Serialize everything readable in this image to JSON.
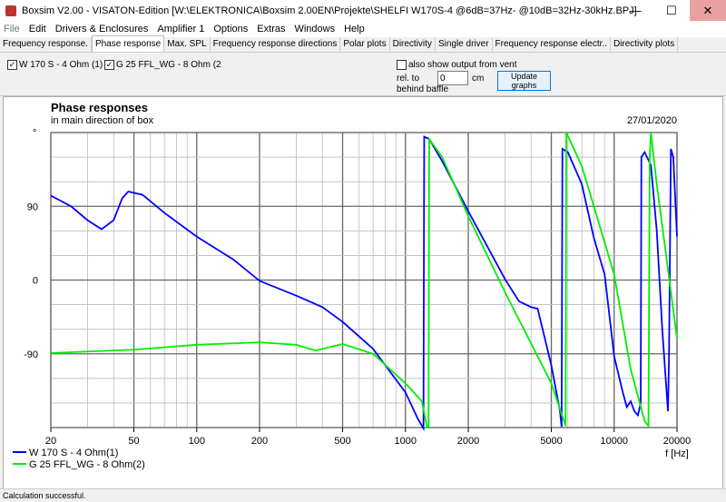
{
  "window": {
    "title": "Boxsim V2.00 - VISATON-Edition [W:\\ELEKTRONICA\\Boxsim 2.00EN\\Projekte\\SHELFI W170S-4 @6dB=37Hz- @10dB=32Hz-30kHz.BPJ]",
    "minimize": "—",
    "maximize": "☐",
    "close": "✕"
  },
  "menu": [
    "File",
    "Edit",
    "Drivers & Enclosures",
    "Amplifier 1",
    "Options",
    "Extras",
    "Windows",
    "Help"
  ],
  "tabs": [
    "Frequency response.",
    "Phase response",
    "Max. SPL",
    "Frequency response directions",
    "Polar plots",
    "Directivity",
    "Single driver",
    "Frequency response electr..",
    "Directivity plots"
  ],
  "active_tab": 1,
  "controls": {
    "driver1": "W 170 S - 4 Ohm (1)",
    "driver2": "G 25 FFL_WG - 8 Ohm (2",
    "vent_label": "also show output from vent",
    "rel_label": "rel. to",
    "behind_label": "behind baffle",
    "distance": "0",
    "unit": "cm",
    "update": "Update graphs"
  },
  "status": "Calculation successful.",
  "chart_data": {
    "type": "line",
    "title": "Phase responses",
    "subtitle": "in main direction of box",
    "date": "27/01/2020",
    "ylabel": "°",
    "xlabel": "f [Hz]",
    "xscale": "log",
    "xlim": [
      20,
      20000
    ],
    "ylim": [
      -180,
      180
    ],
    "xticks": [
      20,
      50,
      100,
      200,
      500,
      1000,
      2000,
      5000,
      10000,
      20000
    ],
    "yticks": [
      90,
      0,
      -90
    ],
    "grid": true,
    "legend": "bottom-left",
    "series": [
      {
        "name": "W 170 S - 4 Ohm(1)",
        "color": "#0000ff",
        "x": [
          20,
          25,
          30,
          35,
          40,
          44,
          47,
          55,
          70,
          100,
          150,
          200,
          300,
          400,
          500,
          700,
          1000,
          1150,
          1220,
          1230,
          1300,
          1500,
          2000,
          3000,
          3500,
          4000,
          4300,
          5000,
          5500,
          5600,
          5650,
          6000,
          7000,
          8000,
          9000,
          10000,
          11000,
          11500,
          12000,
          12500,
          13000,
          13400,
          13500,
          14000,
          15000,
          16000,
          17000,
          18100,
          18300,
          18700,
          19200,
          20000
        ],
        "y": [
          103,
          90,
          73,
          62,
          73,
          100,
          108,
          104,
          82,
          53,
          25,
          -1,
          -19,
          -33,
          -51,
          -84,
          -137,
          -170,
          -181,
          175,
          172,
          145,
          84,
          1,
          -26,
          -33,
          -35,
          -104,
          -160,
          -179,
          160,
          156,
          117,
          51,
          7,
          -93,
          -137,
          -155,
          -148,
          -160,
          -165,
          -150,
          150,
          156,
          140,
          60,
          -60,
          -160,
          -100,
          160,
          150,
          53
        ]
      },
      {
        "name": "G 25 FFL_WG - 8 Ohm(2)",
        "color": "#00ee00",
        "x": [
          20,
          50,
          100,
          200,
          300,
          370,
          400,
          500,
          700,
          1000,
          1200,
          1270,
          1290,
          1300,
          1500,
          2000,
          3000,
          5000,
          5800,
          5850,
          5900,
          7000,
          10000,
          12000,
          14000,
          14600,
          14800,
          15000,
          16000,
          20000
        ],
        "y": [
          -89,
          -85,
          -79,
          -76,
          -79,
          -86,
          -84,
          -78,
          -90,
          -126,
          -148,
          -180,
          -180,
          172,
          150,
          78,
          -15,
          -126,
          -175,
          -178,
          180,
          139,
          7,
          -109,
          -172,
          -178,
          150,
          180,
          117,
          -71
        ]
      }
    ]
  }
}
